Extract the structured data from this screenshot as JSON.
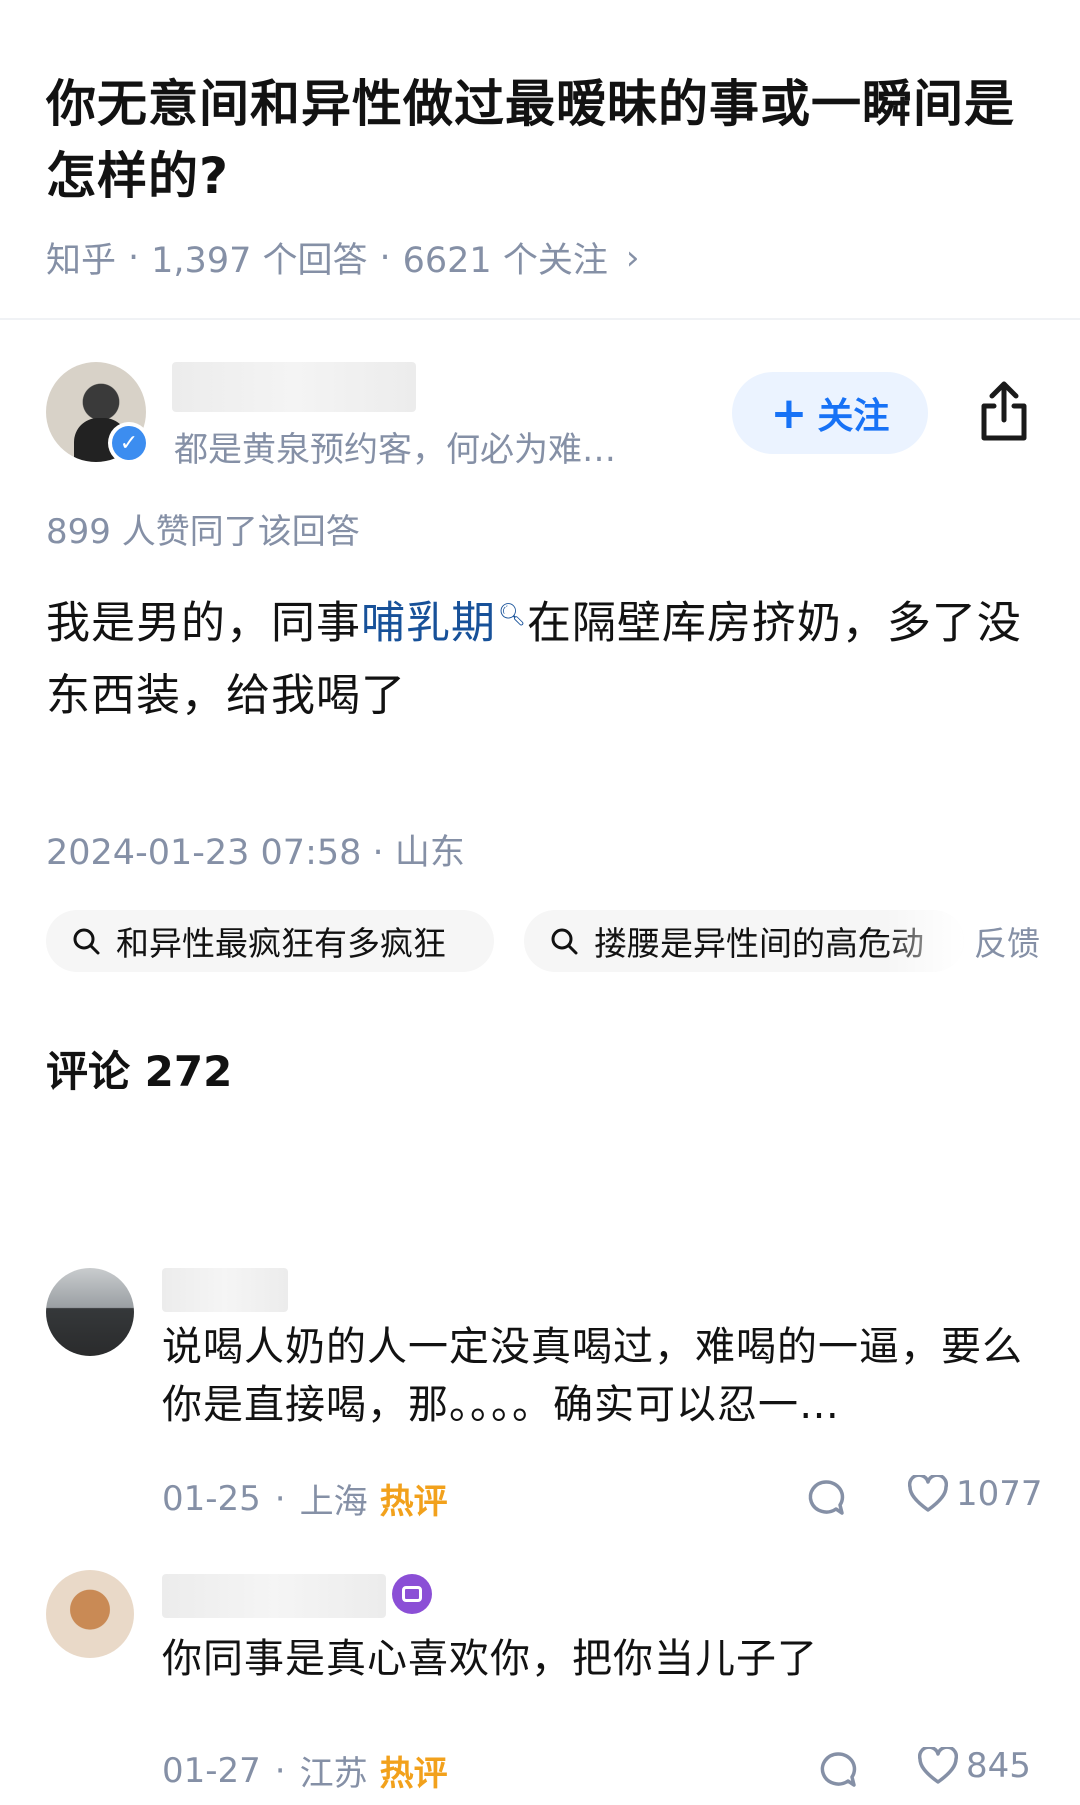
{
  "question": {
    "title": "你无意间和异性做过最暧昧的事或一瞬间是怎样的?",
    "source": "知乎",
    "answers_count": "1,397 个回答",
    "followers_count": "6621 个关注",
    "meta_separator": "·",
    "chevron": "›"
  },
  "author": {
    "bio": "都是黄泉预约客，何必为难…",
    "follow_label": "关注",
    "follow_plus": "+"
  },
  "answer": {
    "likes_text": "899 人赞同了该回答",
    "text_before": "我是男的，同事",
    "keyword": "哺乳期",
    "text_after": "在隔壁库房挤奶，多了没东西装，给我喝了",
    "date": "2024-01-23 07:58",
    "location": "山东",
    "meta_separator": "·"
  },
  "related_searches": [
    {
      "label": "和异性最疯狂有多疯狂"
    },
    {
      "label": "搂腰是异性间的高危动"
    }
  ],
  "feedback_label": "反馈",
  "comments": {
    "title": "评论 272",
    "items": [
      {
        "text": "说喝人奶的人一定没真喝过，难喝的一逼，要么你是直接喝，那。。。。确实可以忍一…",
        "date": "01-25",
        "location": "上海",
        "hot_label": "热评",
        "likes": "1077"
      },
      {
        "text": "你同事是真心喜欢你，把你当儿子了",
        "date": "01-27",
        "location": "江苏",
        "hot_label": "热评",
        "likes": "845"
      }
    ],
    "meta_separator": "·"
  },
  "colors": {
    "brand_blue": "#1772f6",
    "keyword_blue": "#175199",
    "meta_gray": "#8590a6",
    "hot_orange": "#f2a11c",
    "follow_bg": "#ebf3ff"
  },
  "icons": {
    "share": "share-icon",
    "search": "search-icon",
    "reply": "comment-reply-icon",
    "like": "heart-icon",
    "verified": "verified-badge-icon"
  }
}
